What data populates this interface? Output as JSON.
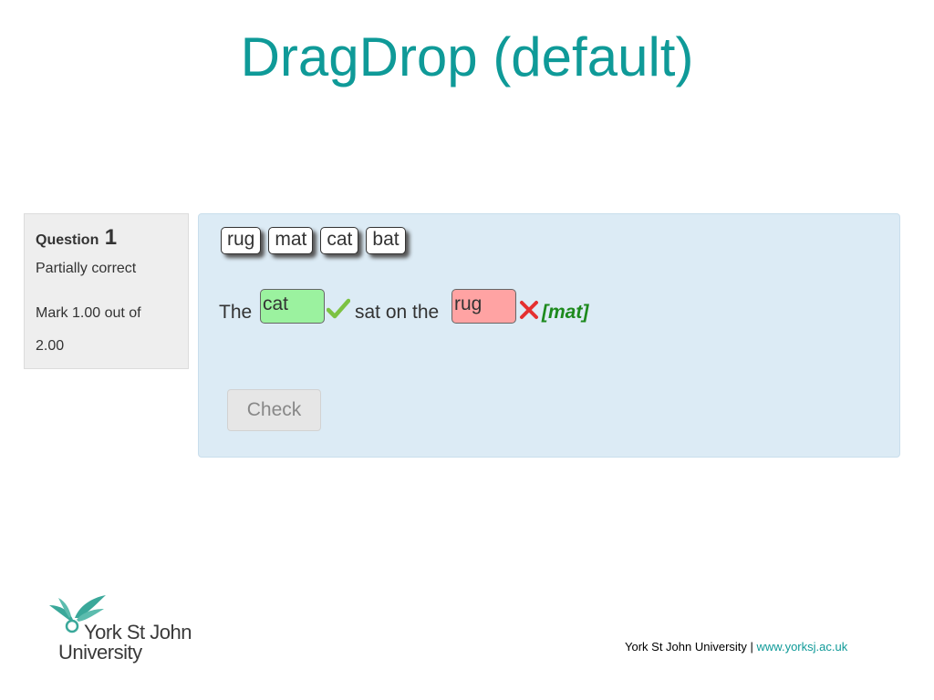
{
  "slide": {
    "title": "DragDrop (default)"
  },
  "question_info": {
    "label": "Question",
    "number": "1",
    "state": "Partially correct",
    "grade": "Mark 1.00 out of 2.00"
  },
  "drag_choices": [
    "rug",
    "mat",
    "cat",
    "bat"
  ],
  "sentence": {
    "part1": "The",
    "drop1": {
      "value": "cat",
      "status": "correct"
    },
    "part2": "sat on the",
    "drop2": {
      "value": "rug",
      "status": "incorrect"
    },
    "right_answer": "[mat]"
  },
  "check_button": {
    "label": "Check"
  },
  "footer": {
    "logo_line1": "York St John",
    "logo_line2": "University",
    "org": "York St John University | ",
    "url": "www.yorksj.ac.uk"
  },
  "colors": {
    "accent": "#0f9a98",
    "correct_bg": "#9bf29f",
    "incorrect_bg": "#ffa3a3",
    "panel_bg": "#dcebf5"
  }
}
